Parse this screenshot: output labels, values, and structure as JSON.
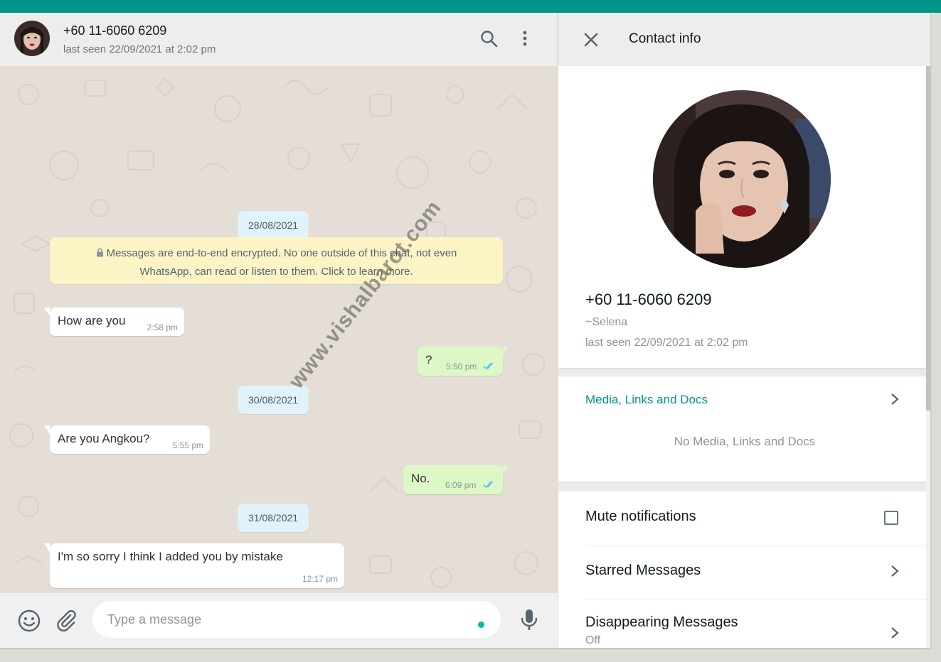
{
  "chat_header": {
    "name": "+60 11-6060 6209",
    "status": "last seen 22/09/2021 at 2:02 pm",
    "icons": [
      "search-icon",
      "menu-dots-icon"
    ]
  },
  "messages": {
    "date1": "28/08/2021",
    "encryption": "Messages are end-to-end encrypted. No one outside of this chat, not even WhatsApp, can read or listen to them. Click to learn more.",
    "m1": {
      "text": "How are you",
      "time": "2:58 pm",
      "direction": "incoming"
    },
    "m2": {
      "text": "?",
      "time": "5:50 pm",
      "direction": "outgoing",
      "status": "read"
    },
    "date2": "30/08/2021",
    "m3": {
      "text": "Are you Angkou?",
      "time": "5:55 pm",
      "direction": "incoming"
    },
    "m4": {
      "text": "No.",
      "time": "6:09 pm",
      "direction": "outgoing",
      "status": "read"
    },
    "date3": "31/08/2021",
    "m5": {
      "text": "I'm so sorry I think I added you by mistake",
      "time": "12:17 pm",
      "direction": "incoming"
    }
  },
  "watermark": "www.vishalbarot.com",
  "composer": {
    "placeholder": "Type a message",
    "icons": [
      "emoji-icon",
      "attach-icon",
      "mic-icon"
    ]
  },
  "contact_info": {
    "title": "Contact info",
    "phone": "+60 11-6060 6209",
    "about": "~Selena",
    "last_seen": "last seen 22/09/2021 at 2:02 pm",
    "media_title": "Media, Links and Docs",
    "media_empty": "No Media, Links and Docs",
    "mute_label": "Mute notifications",
    "mute_checked": false,
    "starred_label": "Starred Messages",
    "disappearing_label": "Disappearing Messages",
    "disappearing_value": "Off"
  },
  "colors": {
    "accent": "#009688",
    "outgoing_bubble": "#dcf8c6",
    "date_chip": "#e1f2fb",
    "encryption_note": "#fdf4c5",
    "read_ticks": "#4fc3f7"
  }
}
